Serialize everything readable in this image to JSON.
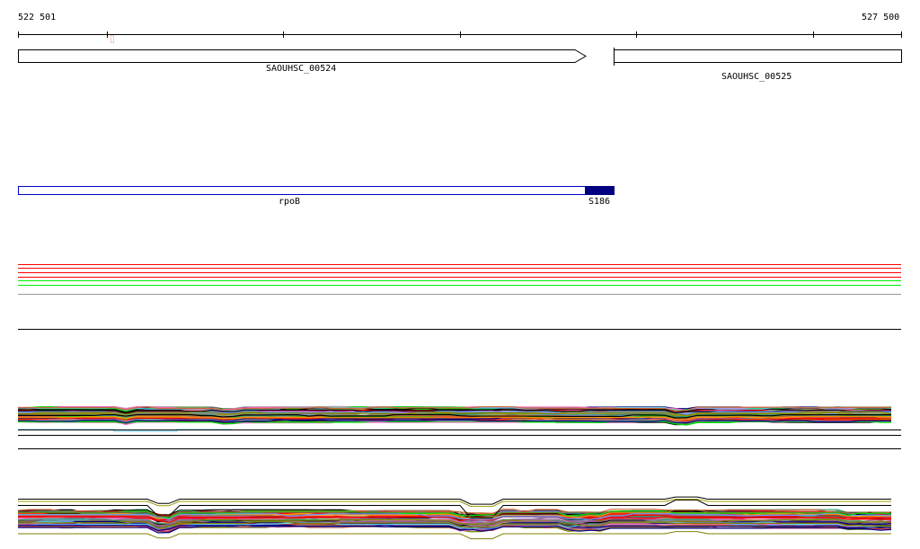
{
  "ruler": {
    "start_label": "522 501",
    "end_label": "527 500"
  },
  "genes": [
    {
      "name": "SAOUHSC_00524",
      "strand": "+"
    },
    {
      "name": "SAOUHSC_00525",
      "strand": "-"
    }
  ],
  "feature": {
    "name": "rpoB",
    "mutation": "S186",
    "outline_color": "#0000cc",
    "highlight_color": "#000080"
  },
  "variant_track_colors": [
    "#ff0000",
    "#ff0000",
    "#ff0000",
    "#ff0000",
    "#00ee00",
    "#00ee00",
    "#999999"
  ],
  "coverage_palette": [
    "#000000",
    "#999900",
    "#ff0000",
    "#00dd00",
    "#66ccff",
    "#cc3366",
    "#cc6633",
    "#996699",
    "#808000",
    "#ff9900",
    "#6699ff",
    "#990000",
    "#ff66cc",
    "#339966",
    "#996633",
    "#000080",
    "#aaaaaa",
    "#cc0066"
  ]
}
